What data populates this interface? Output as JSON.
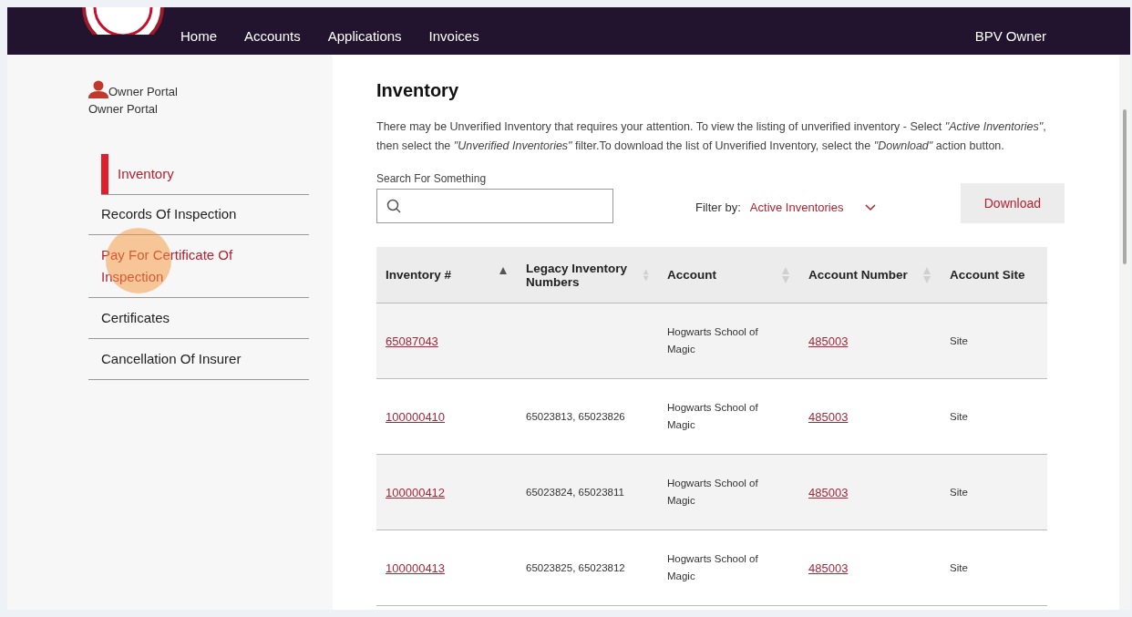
{
  "nav": {
    "links": [
      "Home",
      "Accounts",
      "Applications",
      "Invoices"
    ],
    "user": "BPV Owner"
  },
  "sidebar": {
    "portal_title": "Owner Portal",
    "portal_subtitle": "Owner Portal",
    "items": [
      {
        "label": "Inventory",
        "selected": true,
        "hovered": false
      },
      {
        "label": "Records Of Inspection",
        "selected": false,
        "hovered": false
      },
      {
        "label": "Pay For Certificate Of Inspection",
        "selected": false,
        "hovered": true
      },
      {
        "label": "Certificates",
        "selected": false,
        "hovered": false
      },
      {
        "label": "Cancellation Of Insurer",
        "selected": false,
        "hovered": false
      }
    ]
  },
  "main": {
    "title": "Inventory",
    "description": "There may be Unverified Inventory that requires your attention. To view the listing of unverified inventory - Select *\"Active Inventories\"*, then select the *\"Unverified Inventories\"* filter.To download the list of Unverified Inventory, select the *\"Download\"* action button.",
    "search": {
      "label": "Search For Something"
    },
    "filter": {
      "label": "Filter by:",
      "value": "Active Inventories"
    },
    "download_button": "Download"
  },
  "table": {
    "columns": [
      {
        "label": "Inventory #",
        "sorted": true
      },
      {
        "label": "Legacy Inventory Numbers",
        "sorted": false
      },
      {
        "label": "Account",
        "sorted": false
      },
      {
        "label": "Account Number",
        "sorted": false
      },
      {
        "label": "Account Site"
      }
    ],
    "rows": [
      {
        "inventory": "65087043",
        "account": "Hogwarts School of Magic",
        "account_number": "485003",
        "site": "Site"
      },
      {
        "inventory": "100000410",
        "legacy": "65023813, 65023826",
        "account": "Hogwarts School of Magic",
        "account_number": "485003",
        "site": "Site"
      },
      {
        "inventory": "100000412",
        "legacy": "65023824, 65023811",
        "account": "Hogwarts School of Magic",
        "account_number": "485003",
        "site": "Site"
      },
      {
        "inventory": "100000413",
        "legacy": "65023825, 65023812",
        "account": "Hogwarts School of Magic",
        "account_number": "485003",
        "site": "Site"
      }
    ]
  }
}
